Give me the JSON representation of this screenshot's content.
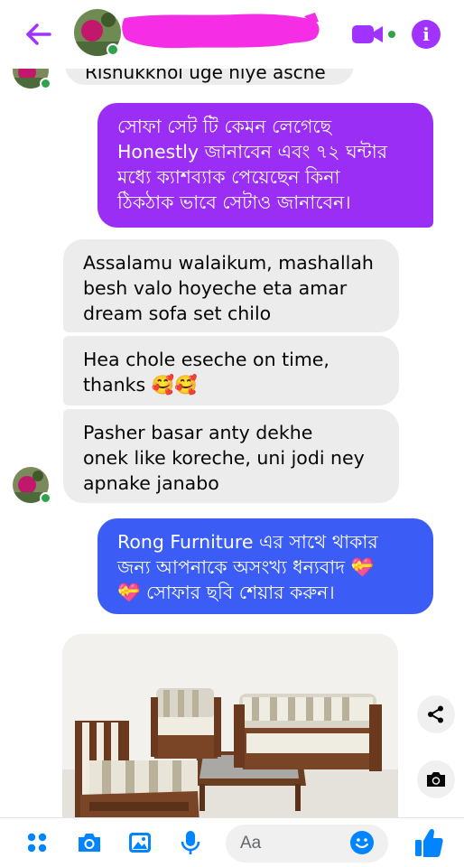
{
  "header": {
    "back_icon": "arrow-left-icon",
    "contact_name": "",
    "video_icon": "video-camera-icon",
    "info_label": "i",
    "accent_color": "#a033ff"
  },
  "messages": {
    "partial_top": "Rishukkhoi uge niye asche",
    "out_1": {
      "lines": [
        "সোফা সেট টি কেমন লেগেছে",
        "Honestly জানাবেন এবং ৭২ ঘন্টার",
        "মধ্যে ক্যাশব্যাক পেয়েছেন কিনা",
        "ঠিকঠাক ভাবে সেটাও জানাবেন।"
      ],
      "color": "#9b2ef5"
    },
    "in_1": {
      "lines": [
        "Assalamu walaikum, mashallah",
        "besh valo hoyeche eta amar",
        "dream sofa set chilo"
      ]
    },
    "in_2": {
      "lines": [
        "Hea chole eseche on time,",
        "thanks 🥰🥰"
      ]
    },
    "in_3": {
      "lines": [
        "Pasher basar anty dekhe",
        "onek like koreche, uni jodi ney",
        "apnake janabo"
      ]
    },
    "out_2": {
      "lines": [
        "Rong Furniture এর সাথে থাকার",
        "জন্য আপনাকে অসংখ্য ধন্যবাদ 💝",
        "💝 সোফার ছবি শেয়ার করুন।"
      ],
      "color": "#3b5df5"
    },
    "photo_icon": "sofa-set-photo"
  },
  "side_actions": {
    "share_icon": "share-icon",
    "camera_icon": "camera-icon"
  },
  "composer": {
    "menu_icon": "four-dots-icon",
    "camera_icon": "camera-icon",
    "gallery_icon": "image-icon",
    "mic_icon": "microphone-icon",
    "input_placeholder": "Aa",
    "emoji_icon": "smiley-icon",
    "like_icon": "thumbs-up-icon"
  }
}
